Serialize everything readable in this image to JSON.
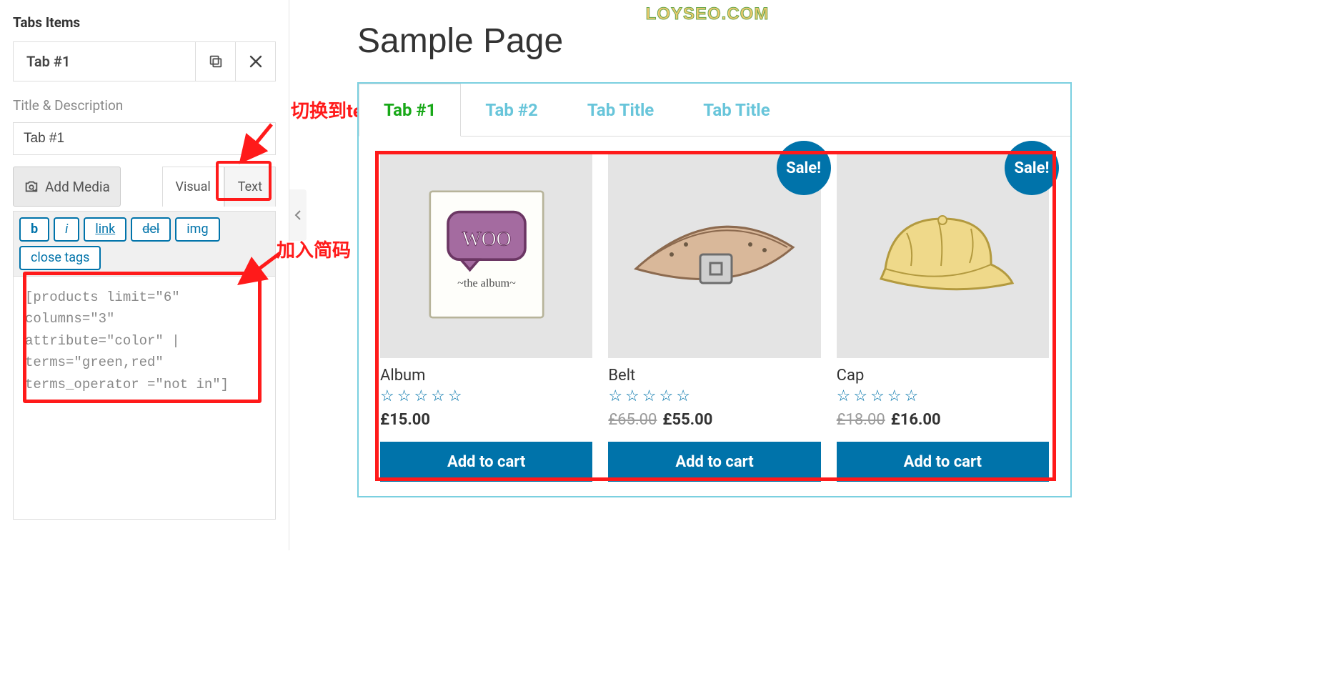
{
  "sidebar": {
    "section_title": "Tabs Items",
    "tab_item_label": "Tab #1",
    "subtitle": "Title & Description",
    "title_input_value": "Tab #1",
    "add_media_label": "Add Media",
    "editor_tabs": {
      "visual": "Visual",
      "text": "Text"
    },
    "quicktags": {
      "bold": "b",
      "italic": "i",
      "link": "link",
      "del": "del",
      "img": "img",
      "close_tags": "close tags"
    },
    "code": "[products limit=\"6\"\ncolumns=\"3\"\nattribute=\"color\" |\nterms=\"green,red\"\nterms_operator =\"not in\"]"
  },
  "annotations": {
    "switch_text": "切换到text模式",
    "add_shortcode": "加入简码"
  },
  "watermark": "LOYSEO.COM",
  "preview": {
    "page_title": "Sample Page",
    "tabs": [
      "Tab #1",
      "Tab #2",
      "Tab Title",
      "Tab Title"
    ],
    "sale_label": "Sale!",
    "products": [
      {
        "name": "Album",
        "price": "£15.00",
        "old_price": "",
        "on_sale": false,
        "icon": "album"
      },
      {
        "name": "Belt",
        "price": "£55.00",
        "old_price": "£65.00",
        "on_sale": true,
        "icon": "belt"
      },
      {
        "name": "Cap",
        "price": "£16.00",
        "old_price": "£18.00",
        "on_sale": true,
        "icon": "cap"
      }
    ],
    "add_to_cart": "Add to cart"
  }
}
